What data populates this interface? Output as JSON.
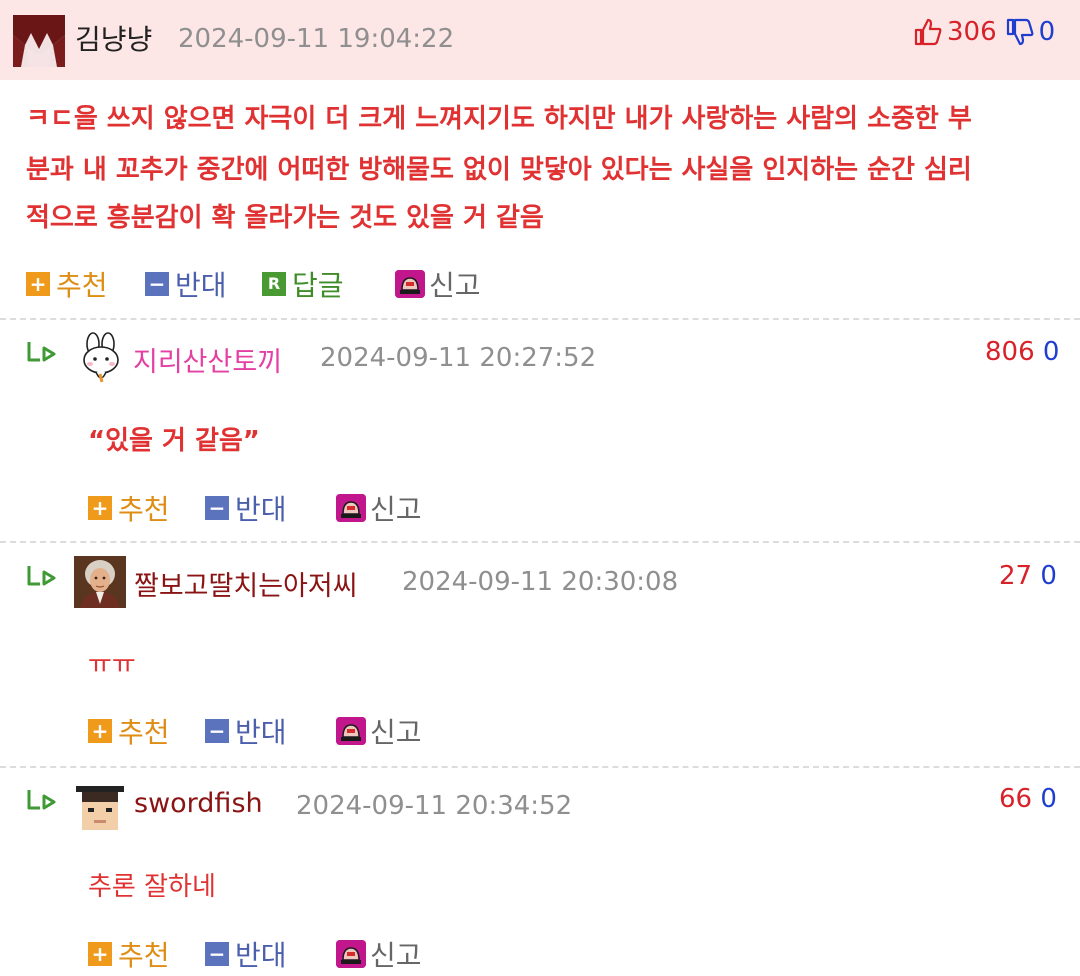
{
  "post": {
    "author": "김냥냥",
    "date": "2024-09-11 19:04:22",
    "up_count": "306",
    "down_count": "0",
    "body_lines": [
      "ㅋㄷ을 쓰지 않으면 자극이 더 크게 느껴지기도 하지만 내가 사랑하는 사람의 소중한 부",
      "분과 내 꼬추가 중간에 어떠한 방해물도 없이 맞닿아 있다는 사실을 인지하는 순간 심리",
      "적으로 흥분감이 확 올라가는 것도 있을 거 같음"
    ],
    "actions": {
      "recommend": "추천",
      "oppose": "반대",
      "reply": "답글",
      "report": "신고"
    },
    "reply_badge": "R"
  },
  "comments": [
    {
      "author": "지리산산토끼",
      "date": "2024-09-11 20:27:52",
      "up": "806",
      "down": "0",
      "text": "“있을 거 같음”",
      "actions": {
        "recommend": "추천",
        "oppose": "반대",
        "report": "신고"
      }
    },
    {
      "author": "짤보고딸치는아저씨",
      "date": "2024-09-11 20:30:08",
      "up": "27",
      "down": "0",
      "text": "ㅠㅠ",
      "actions": {
        "recommend": "추천",
        "oppose": "반대",
        "report": "신고"
      }
    },
    {
      "author": "swordfish",
      "date": "2024-09-11 20:34:52",
      "up": "66",
      "down": "0",
      "text": "추론 잘하네",
      "actions": {
        "recommend": "추천",
        "oppose": "반대",
        "report": "신고"
      }
    }
  ],
  "colors": {
    "header_bg": "#fde6e6",
    "body_text": "#e03232",
    "up_vote": "#d8222a",
    "down_vote": "#1f3ecf"
  },
  "icons": {
    "post_up": "thumbs-up-icon",
    "post_down": "thumbs-down-icon",
    "recommend": "plus-badge-icon",
    "oppose": "minus-badge-icon",
    "reply": "reply-badge-icon",
    "report": "siren-icon",
    "comment_reply": "reply-arrow-icon"
  }
}
